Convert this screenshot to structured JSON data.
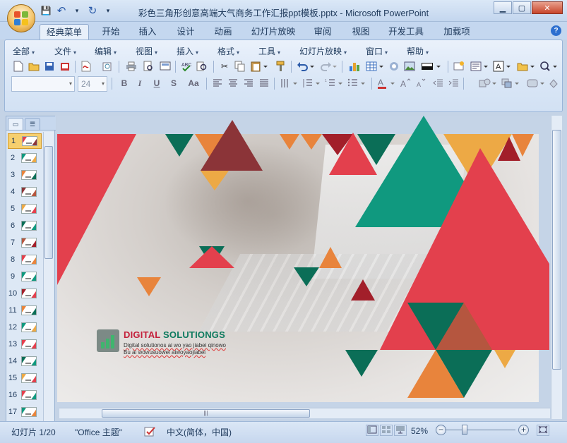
{
  "window": {
    "title": "彩色三角形创意高端大气商务工作汇报ppt模板.pptx - Microsoft PowerPoint",
    "min_label": "▁",
    "max_label": "▢",
    "close_label": "✕"
  },
  "qat": {
    "save": "💾",
    "undo": "↶",
    "redo": "↻",
    "more": "▾"
  },
  "tabs": [
    {
      "label": "经典菜单",
      "active": true
    },
    {
      "label": "开始"
    },
    {
      "label": "插入"
    },
    {
      "label": "设计"
    },
    {
      "label": "动画"
    },
    {
      "label": "幻灯片放映"
    },
    {
      "label": "审阅"
    },
    {
      "label": "视图"
    },
    {
      "label": "开发工具"
    },
    {
      "label": "加载项"
    }
  ],
  "help_label": "?",
  "menus": [
    "全部",
    "文件",
    "编辑",
    "视图",
    "插入",
    "格式",
    "工具",
    "幻灯片放映",
    "窗口",
    "帮助"
  ],
  "font_size_value": "24",
  "format_buttons": {
    "bold": "B",
    "italic": "I",
    "underline": "U",
    "shadow": "S",
    "case": "Aa"
  },
  "left_panel": {
    "tab_slides_icon": "▭",
    "tab_outline_icon": "☰",
    "slide_numbers": [
      "1",
      "2",
      "3",
      "4",
      "5",
      "6",
      "7",
      "8",
      "9",
      "10",
      "11",
      "12",
      "13",
      "14",
      "15",
      "16",
      "17"
    ],
    "active_slide": 1
  },
  "slide": {
    "brand_part1": "DIGITAL",
    "brand_part2": "SOLUTIONGS",
    "subtitle_line1": "Digital solutionos ai wo yao jiabei qinowo",
    "subtitle_line2": "Bu ai wowusuowei aiwoyaojiabei"
  },
  "colors": {
    "red": "#e3404d",
    "dark_red": "#a21f2a",
    "maroon": "#8b3438",
    "teal": "#10997f",
    "dark_teal": "#0b6e57",
    "orange": "#e8843c",
    "yellow": "#eda945",
    "rust": "#b5563f"
  },
  "hscroll_grip": "|||",
  "status": {
    "slide_info": "幻灯片 1/20",
    "theme": "\"Office 主题\"",
    "language": "中文(简体，中国)",
    "zoom": "52%",
    "zoom_minus": "−",
    "zoom_plus": "+"
  }
}
